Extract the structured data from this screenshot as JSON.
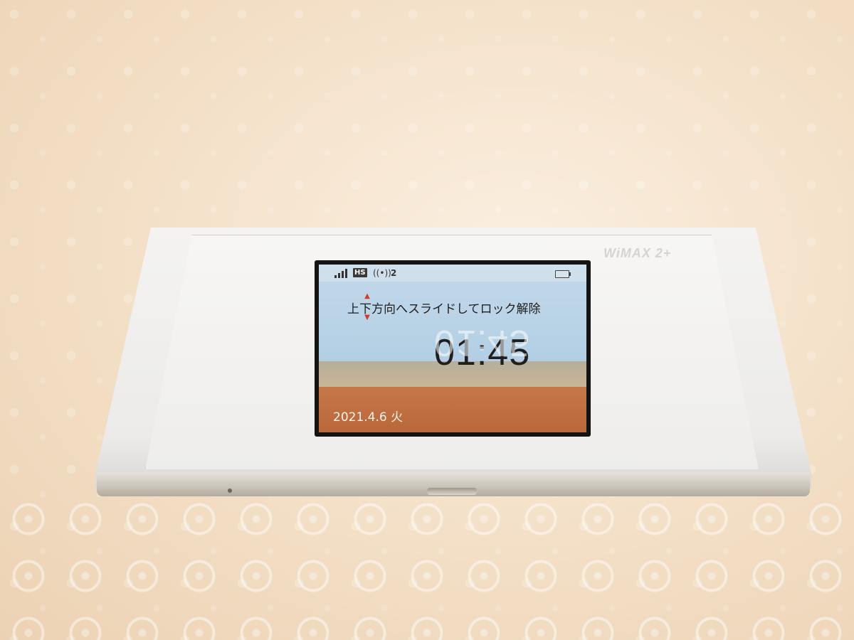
{
  "device": {
    "brand": "WiMAX 2+",
    "status": {
      "signal_icon": "signal-bars-icon",
      "mode_badge": "HS",
      "wifi_icon": "wifi-broadcast-icon",
      "wifi_symbol": "((•))",
      "connected_clients": "2",
      "battery_icon": "battery-icon"
    },
    "lock_screen": {
      "instruction": "上下方向へスライドしてロック解除",
      "time": "01:45",
      "date": "2021.4.6 火"
    }
  },
  "colors": {
    "sky": "#b4cfe4",
    "sea": "#c6784a",
    "arrow_accent": "#d23a2a"
  }
}
